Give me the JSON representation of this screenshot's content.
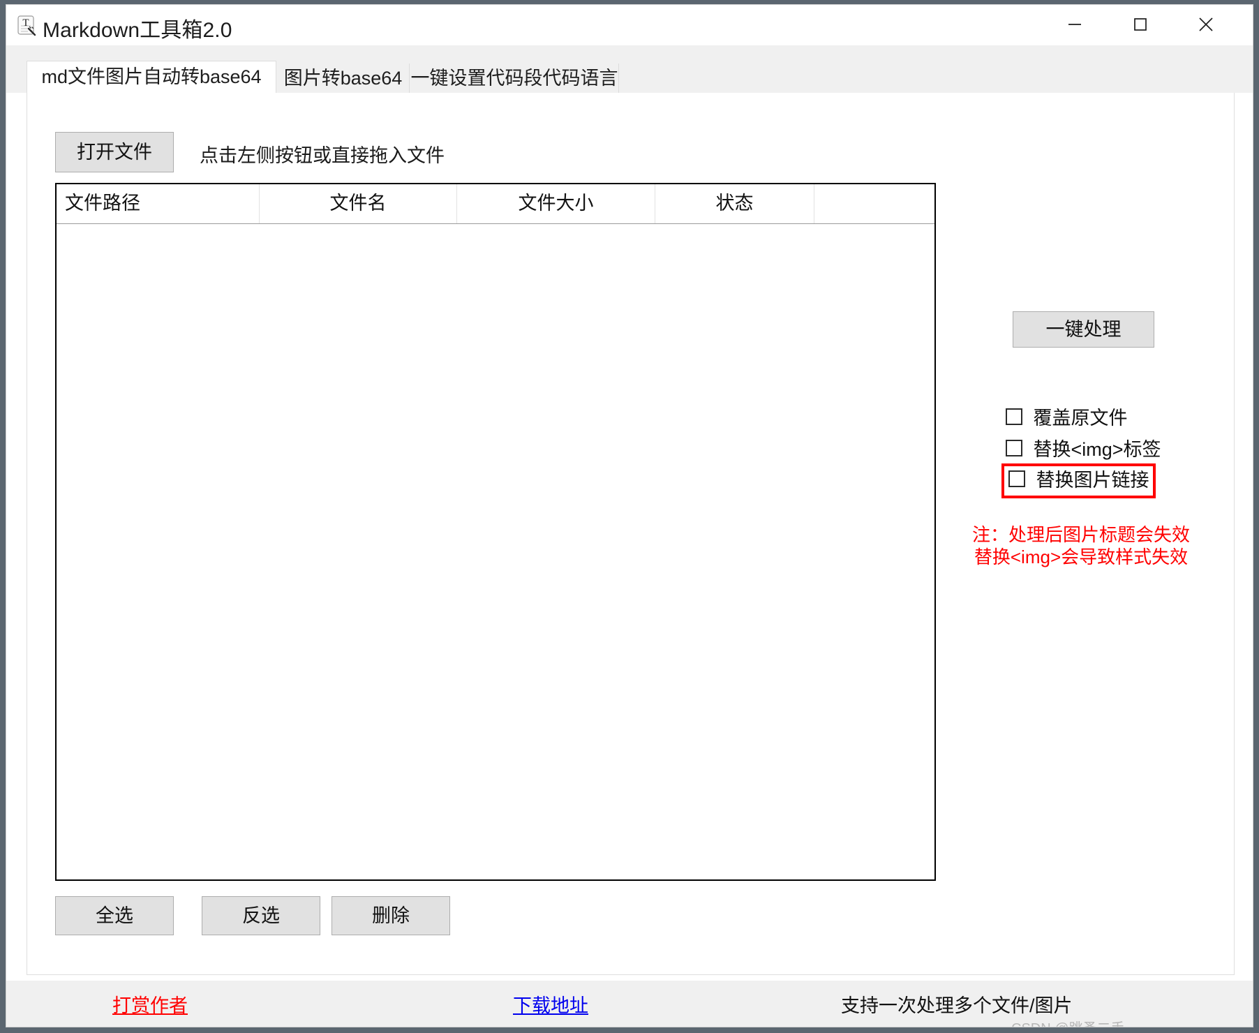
{
  "window": {
    "title": "Markdown工具箱2.0",
    "icon": "markdown-toolbox-icon",
    "controls": {
      "minimize": "minimize-icon",
      "maximize": "maximize-icon",
      "close": "close-icon"
    }
  },
  "tabs": [
    {
      "label": "md文件图片自动转base64",
      "active": true
    },
    {
      "label": "图片转base64",
      "active": false
    },
    {
      "label": "一键设置代码段代码语言",
      "active": false
    }
  ],
  "toolbar": {
    "open_file_label": "打开文件",
    "hint": "点击左侧按钮或直接拖入文件"
  },
  "file_table": {
    "columns": [
      "文件路径",
      "文件名",
      "文件大小",
      "状态",
      ""
    ],
    "rows": []
  },
  "list_actions": {
    "select_all": "全选",
    "invert": "反选",
    "delete": "删除"
  },
  "right_panel": {
    "process_label": "一键处理",
    "options": [
      {
        "label": "覆盖原文件",
        "checked": false,
        "highlighted": false
      },
      {
        "label": "替换<img>标签",
        "checked": false,
        "highlighted": false
      },
      {
        "label": "替换图片链接",
        "checked": false,
        "highlighted": true
      }
    ],
    "note_lines": [
      "注：处理后图片标题会失效",
      "替换<img>会导致样式失效"
    ]
  },
  "footer": {
    "donate": "打赏作者",
    "download": "下载地址",
    "note": "支持一次处理多个文件/图片",
    "watermark": "CSDN @跳蚤二手"
  },
  "colors": {
    "highlight_red": "#ff0000",
    "link_blue": "#0000ee",
    "button_face": "#e1e1e1",
    "panel_gray": "#f0f0f0"
  }
}
